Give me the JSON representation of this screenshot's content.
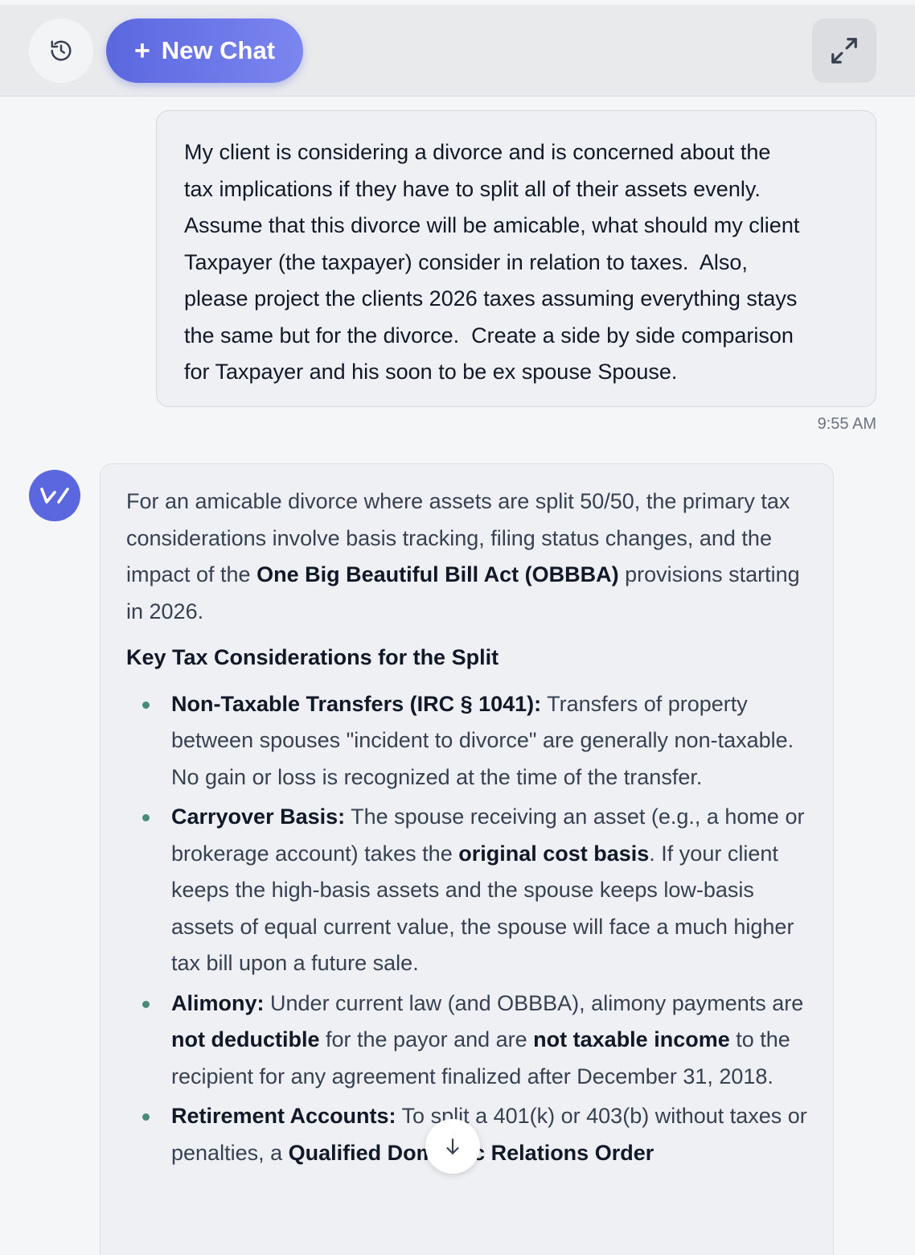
{
  "toolbar": {
    "history_icon": "history-icon",
    "new_chat_label": "New Chat",
    "new_chat_plus": "+",
    "expand_icon": "expand-icon"
  },
  "user_message": {
    "text": "My client is considering a divorce and is concerned about the\ntax implications if they have to split all of their assets evenly.\nAssume that this divorce will be amicable, what should my client\nTaxpayer (the taxpayer) consider in relation to taxes.  Also,\nplease project the clients 2026 taxes assuming everything stays\nthe same but for the divorce.  Create a side by side comparison\nfor Taxpayer and his soon to be ex spouse Spouse.",
    "time": "9:55 AM"
  },
  "assistant": {
    "avatar_icon": "assistant-logo-icon",
    "intro_pre": "For an amicable divorce where assets are split 50/50, the primary tax considerations involve basis tracking, filing status changes, and the impact of the ",
    "intro_bold": "One Big Beautiful Bill Act (OBBBA)",
    "intro_post": " provisions starting in 2026.",
    "heading": "Key Tax Considerations for the Split",
    "items": [
      {
        "title": "Non-Taxable Transfers (IRC § 1041):",
        "text": " Transfers of property between spouses \"incident to divorce\" are generally non-taxable. No gain or loss is recognized at the time of the transfer."
      },
      {
        "title": "Carryover Basis:",
        "text_a": " The spouse receiving an asset (e.g., a home or brokerage account) takes the ",
        "bold_a": "original cost basis",
        "text_b": ". If your client keeps the high-basis assets and the spouse keeps low-basis assets of equal current value, the spouse will face a much higher tax bill upon a future sale."
      },
      {
        "title": "Alimony:",
        "text_a": " Under current law (and OBBBA), alimony payments are ",
        "bold_a": "not deductible",
        "text_b": " for the payor and are ",
        "bold_b": "not taxable income",
        "text_c": " to the recipient for any agreement finalized after December 31, 2018."
      },
      {
        "title": "Retirement Accounts:",
        "text_a": " To split a 401(k) or 403(b) without taxes or penalties, a ",
        "bold_a": "Qualified Domestic Relations Order"
      }
    ]
  },
  "scroll_button_icon": "arrow-down-icon"
}
